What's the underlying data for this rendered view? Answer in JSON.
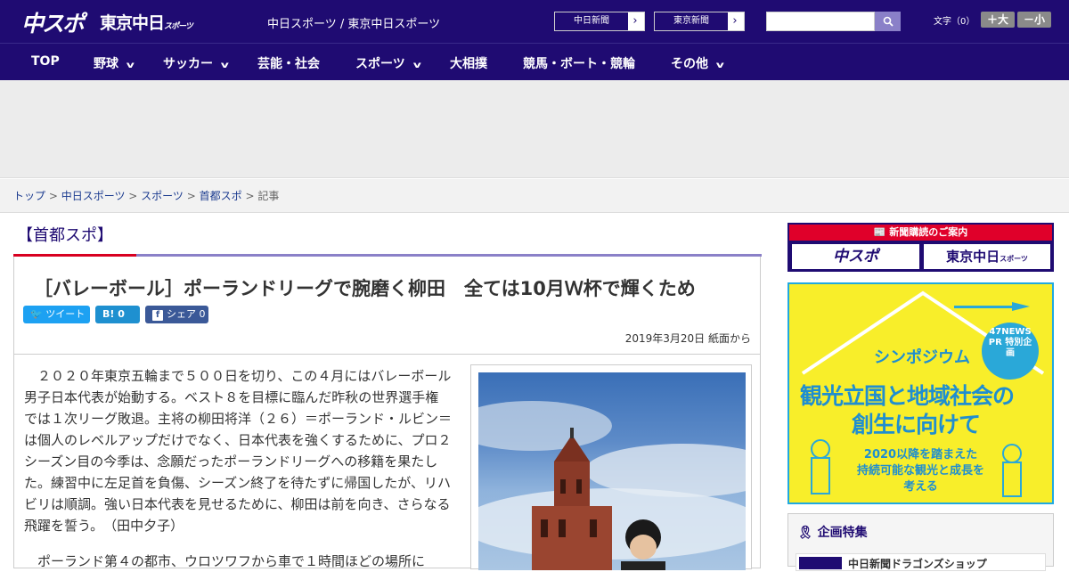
{
  "header": {
    "logo_main": "中スポ",
    "logo_tokyo": "東京中日",
    "logo_tokyo_sub": "スポーツ",
    "site_name": "中日スポーツ / 東京中日スポーツ",
    "link1": "中日新聞",
    "link2": "東京新聞",
    "font_size_label": "文字（0）",
    "font_large": "＋大",
    "font_small": "－小"
  },
  "nav": {
    "items": [
      {
        "label": "TOP",
        "has_menu": false
      },
      {
        "label": "野球",
        "has_menu": true
      },
      {
        "label": "サッカー",
        "has_menu": true
      },
      {
        "label": "芸能・社会",
        "has_menu": false
      },
      {
        "label": "スポーツ",
        "has_menu": true
      },
      {
        "label": "大相撲",
        "has_menu": false
      },
      {
        "label": "競馬・ボート・競輪",
        "has_menu": false
      },
      {
        "label": "その他",
        "has_menu": true
      }
    ]
  },
  "breadcrumb": {
    "items": [
      "トップ",
      "中日スポーツ",
      "スポーツ",
      "首都スポ"
    ],
    "current": "記事"
  },
  "article": {
    "category": "【首都スポ】",
    "title": "［バレーボール］ポーランドリーグで腕磨く柳田　全ては10月Ｗ杯で輝くため",
    "tweet": "ツイート",
    "hatena_label": "B!",
    "hatena_count": "0",
    "share_label": "シェア",
    "share_count": "0",
    "date": "2019年3月20日 紙面から",
    "para1": "２０２０年東京五輪まで５００日を切り、この４月にはバレーボール男子日本代表が始動する。ベスト８を目標に臨んだ昨秋の世界選手権では１次リーグ敗退。主将の柳田将洋（２６）＝ポーランド・ルビン＝は個人のレベルアップだけでなく、日本代表を強くするために、プロ２シーズン目の今季は、念願だったポーランドリーグへの移籍を果たした。練習中に左足首を負傷、シーズン終了を待たずに帰国したが、リハビリは順調。強い日本代表を見せるために、柳田は前を向き、さらなる飛躍を誓う。　（田中夕子）",
    "para2": "ポーランド第４の都市、ウロツワフから車で１時間ほどの場所に"
  },
  "sidebar": {
    "subscribe_title": "新聞購読のご案内",
    "sub1": "中スポ",
    "sub2": "東京中日",
    "sub2_small": "スポーツ",
    "banner_badge": "47NEWS PR 特別企画",
    "banner_sympo": "シンポジウム",
    "banner_line1": "観光立国と地域社会の",
    "banner_line2": "創生に向けて",
    "banner_sub1": "2020以降を踏まえた",
    "banner_sub2": "持続可能な観光と成長を",
    "banner_sub3": "考える",
    "plan_title": "企画特集",
    "plan_item": "中日新聞ドラゴンズショップ"
  },
  "colors": {
    "brand": "#1f0b72",
    "accent": "#d80020",
    "link": "#1a3a8f"
  }
}
